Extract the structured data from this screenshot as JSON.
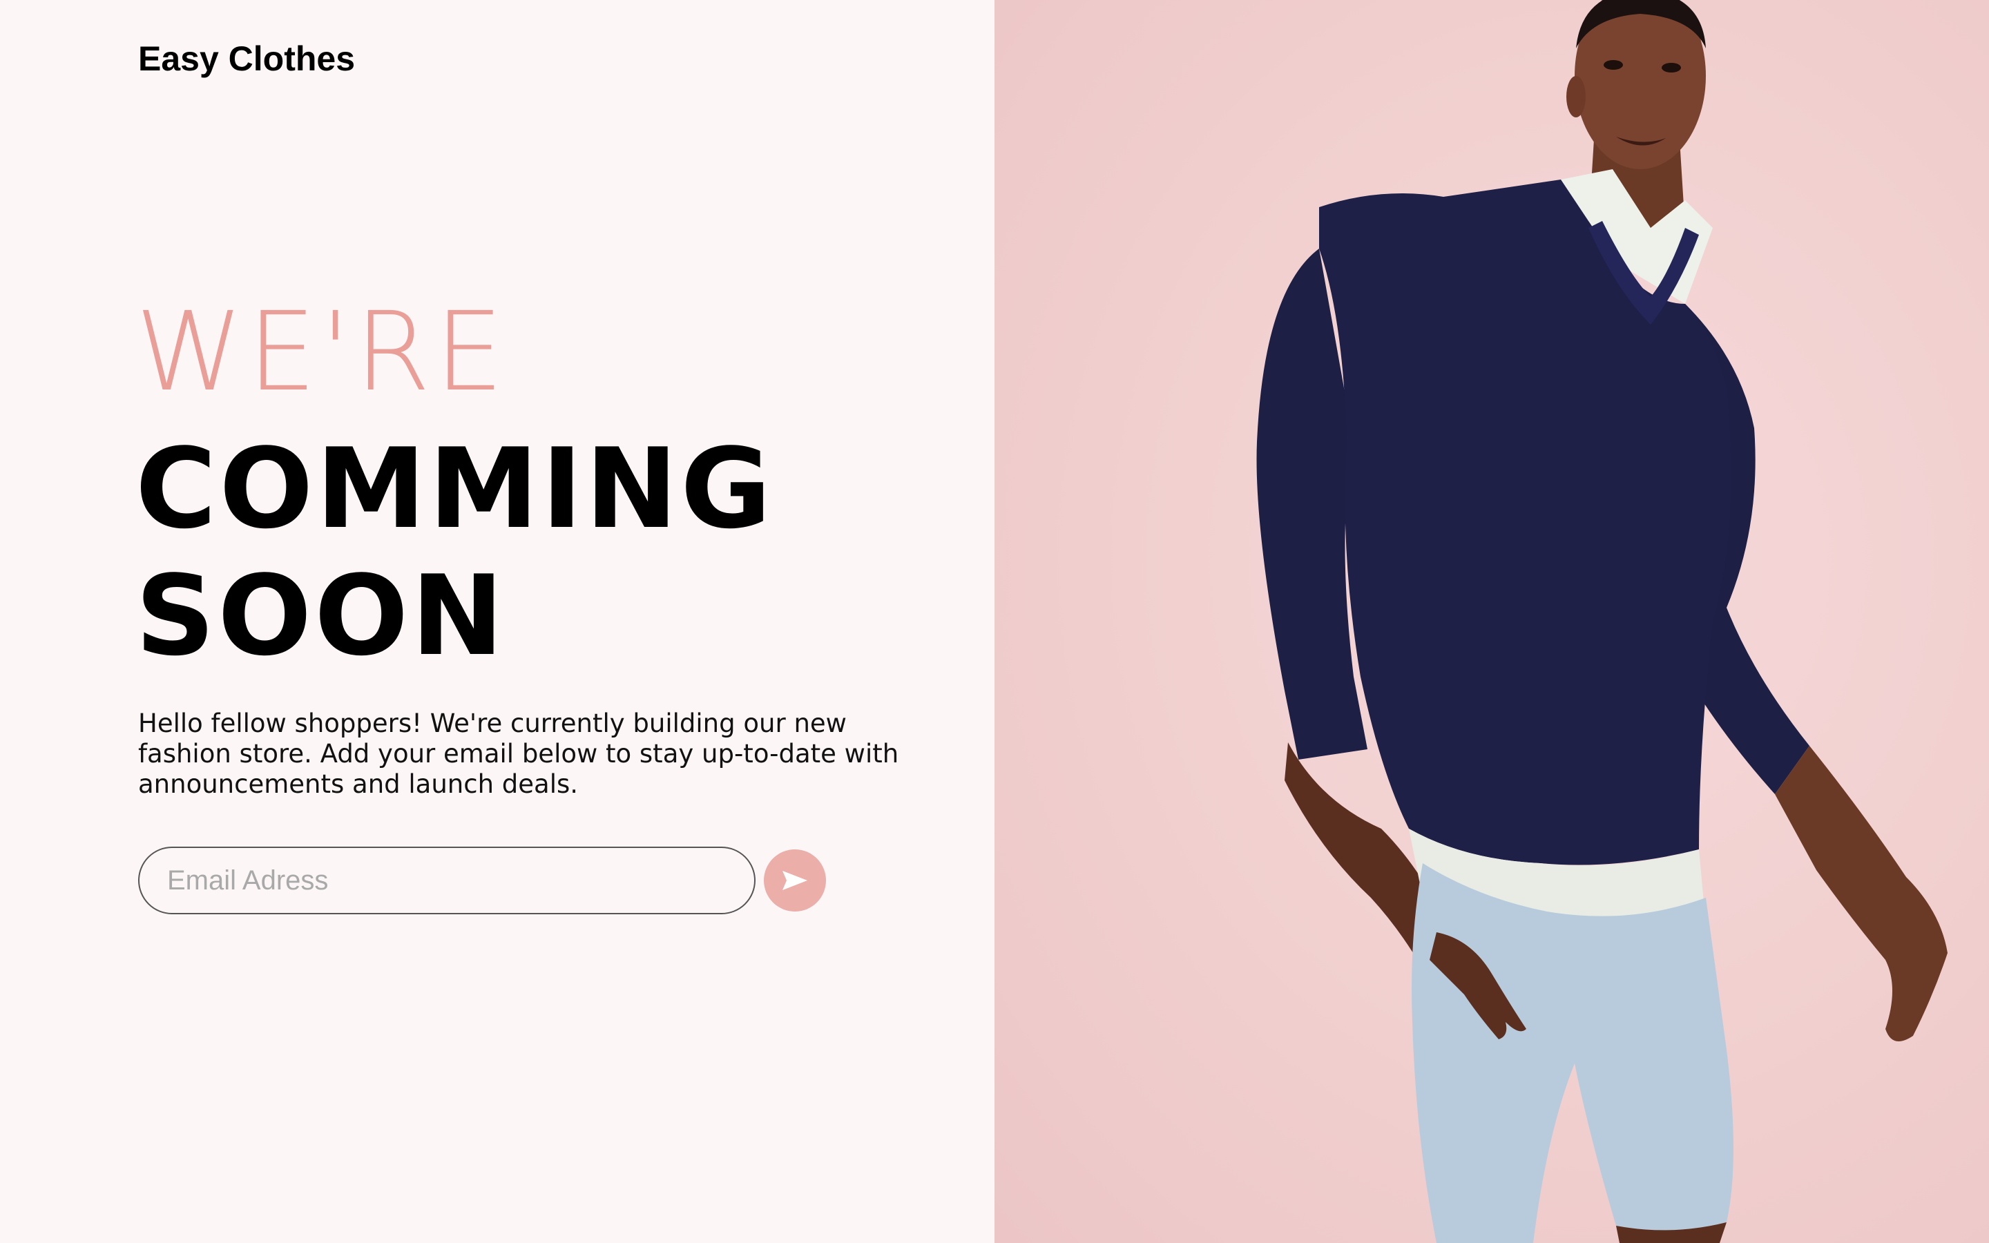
{
  "brand": {
    "name": "Easy Clothes"
  },
  "headline": {
    "line1": "WE'RE",
    "line2": "COMMING",
    "line3": "SOON"
  },
  "description": "Hello fellow shoppers! We're currently building our new fashion store. Add your email below to stay up-to-date with announcements and launch deals.",
  "signup": {
    "email_placeholder": "Email Adress",
    "email_value": "",
    "submit_icon": "send-arrow-icon"
  },
  "hero": {
    "image": "model-in-navy-sweater-and-light-blue-shorts"
  },
  "colors": {
    "accent": "#ea9e98",
    "button": "#ebaea9",
    "left_background": "#fdf6f6",
    "right_background": "#f1cfcf",
    "text": "#000000"
  }
}
